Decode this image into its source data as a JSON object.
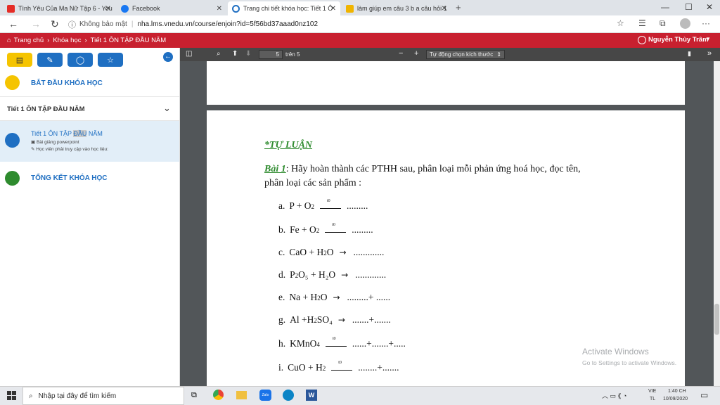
{
  "browser": {
    "tabs": [
      {
        "label": "Tình Yêu Của Ma Nữ Tập 6 - You",
        "icon": "youtube-icon"
      },
      {
        "label": "Facebook",
        "icon": "facebook-icon"
      },
      {
        "label": "Trang chi tiết khóa học: Tiết 1 Ô",
        "icon": "edge-loading-icon"
      },
      {
        "label": "làm giúp em câu 3 b a câu hỏi 1",
        "icon": "hoidap-icon"
      }
    ],
    "address_security": "Không bảo mật",
    "address_url": "nha.lms.vnedu.vn/course/enjoin?id=5f56bd37aaad0nz102"
  },
  "site_header": {
    "breadcrumb": [
      "Trang chủ",
      "Khóa học",
      "Tiết 1 ÔN TẬP ĐẦU NĂM"
    ],
    "user_name": "Nguyễn Thùy Trâm"
  },
  "sidebar": {
    "start_label": "BẮT ĐẦU KHÓA HỌC",
    "section_title": "Tiết 1 ÔN TẬP ĐẦU NĂM",
    "lesson_title_pre": "Tiết 1 ÔN TẬP ",
    "lesson_title_hl": "ĐẦU",
    "lesson_title_post": " NĂM",
    "lesson_sub1": "Bài giảng powerpoint",
    "lesson_sub2": "Học viên phải truy cập vào học liệu:",
    "end_label": "TỔNG KẾT KHÓA HỌC",
    "colors": {
      "start": "#f5c400",
      "lesson": "#1f6fc2",
      "end": "#2e8b2e"
    }
  },
  "pdf_toolbar": {
    "page_current": "5",
    "page_total": "trên 5",
    "zoom": "Tự động chọn kích thước"
  },
  "document": {
    "heading": "*TỰ LUẬN",
    "task_label": "Bài 1",
    "task_text_line1": ": Hãy hoàn thành các PTHH sau, phân loại mỗi phản ứng hoá học, đọc tên,",
    "task_text_line2": "phân loại các sản phẩm :",
    "items": [
      {
        "letter": "a.",
        "formula": "P + O",
        "sub": "2",
        "tail": "",
        "arrow": "t0",
        "result": "........."
      },
      {
        "letter": "b.",
        "formula": "Fe + O",
        "sub": "2",
        "tail": "",
        "arrow": "t0",
        "result": "........."
      },
      {
        "letter": "c.",
        "formula": "CaO + H",
        "sub": "2",
        "tail": "O",
        "arrow": "→",
        "result": "............."
      },
      {
        "letter": "d.",
        "formula": "P",
        "sub": "2",
        "tail": "O₅ + H₂O",
        "arrow": "→",
        "result": "............."
      },
      {
        "letter": "e.",
        "formula": "Na + H",
        "sub": "2",
        "tail": "O",
        "arrow": "→",
        "result": ".........+ ......"
      },
      {
        "letter": "g.",
        "formula": "Al +H",
        "sub": "2",
        "tail": "SO₄",
        "arrow": "→",
        "result": ".......+......."
      },
      {
        "letter": "h.",
        "formula": "KMnO",
        "sub": "4",
        "tail": "",
        "arrow": "t0",
        "result": "......+.......+....."
      },
      {
        "letter": "i.",
        "formula": "CuO + H",
        "sub": "2",
        "tail": "",
        "arrow": "t0",
        "result": "........+......."
      }
    ]
  },
  "watermark": {
    "line1": "Activate Windows",
    "line2": "Go to Settings to activate Windows."
  },
  "taskbar": {
    "search_placeholder": "Nhập tại đây để tìm kiếm",
    "lang1": "VIE",
    "lang2": "TL",
    "time": "1:40 CH",
    "date": "10/09/2020"
  }
}
